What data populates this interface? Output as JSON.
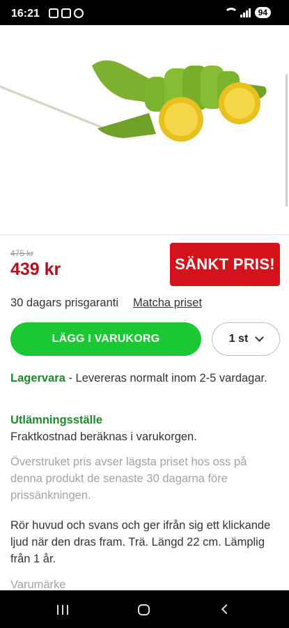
{
  "status_bar": {
    "time": "16:21",
    "battery": "94"
  },
  "product": {
    "old_price": "475 kr",
    "price": "439 kr",
    "badge": "SÄNKT PRIS!",
    "guarantee": "30 dagars prisgaranti",
    "match_link": "Matcha priset",
    "add_to_cart": "LÄGG I VARUKORG",
    "quantity": "1 st"
  },
  "stock": {
    "label": "Lagervara",
    "text": " - Levereras normalt inom 2-5 vardagar."
  },
  "pickup": {
    "label": "Utlämningsställe",
    "text": "Fraktkostnad beräknas i varukorgen."
  },
  "price_note": "Överstruket pris avser lägsta priset hos oss på denna produkt de senaste 30 dagarna före prissänkningen.",
  "description": "Rör huvud och svans och ger ifrån sig ett klickande ljud när den dras fram. Trä. Längd 22 cm. Lämplig från 1 år.",
  "brand_label": "Varumärke",
  "colors": {
    "green": "#19c832",
    "red": "#d3121b",
    "price_red": "#b20f1e",
    "dark_green_text": "#1c8a2c"
  }
}
